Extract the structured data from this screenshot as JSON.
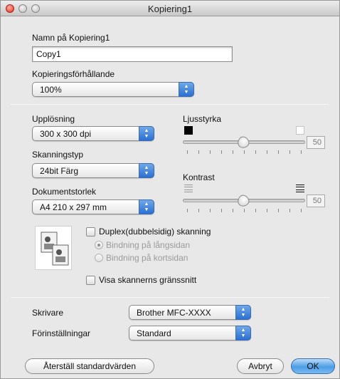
{
  "window": {
    "title": "Kopiering1"
  },
  "name_section": {
    "label": "Namn på Kopiering1",
    "value": "Copy1"
  },
  "ratio_section": {
    "label": "Kopieringsförhållande",
    "value": "100%"
  },
  "resolution": {
    "label": "Upplösning",
    "value": "300 x 300 dpi"
  },
  "scan_type": {
    "label": "Skanningstyp",
    "value": "24bit Färg"
  },
  "doc_size": {
    "label": "Dokumentstorlek",
    "value": "A4  210 x 297 mm"
  },
  "brightness": {
    "label": "Ljusstyrka",
    "value": "50",
    "level": 50
  },
  "contrast": {
    "label": "Kontrast",
    "value": "50",
    "level": 50
  },
  "duplex": {
    "checkbox_label": "Duplex(dubbelsidig) skanning",
    "long_edge": "Bindning på långsidan",
    "short_edge": "Bindning på kortsidan"
  },
  "show_scanner_ui": {
    "label": "Visa skannerns gränssnitt"
  },
  "printer": {
    "label": "Skrivare",
    "value": "Brother MFC-XXXX"
  },
  "presets": {
    "label": "Förinställningar",
    "value": "Standard"
  },
  "buttons": {
    "restore": "Återställ standardvärden",
    "cancel": "Avbryt",
    "ok": "OK"
  },
  "colors": {
    "ok_button": "#4d9de6",
    "close_button": "#e02b1a"
  }
}
